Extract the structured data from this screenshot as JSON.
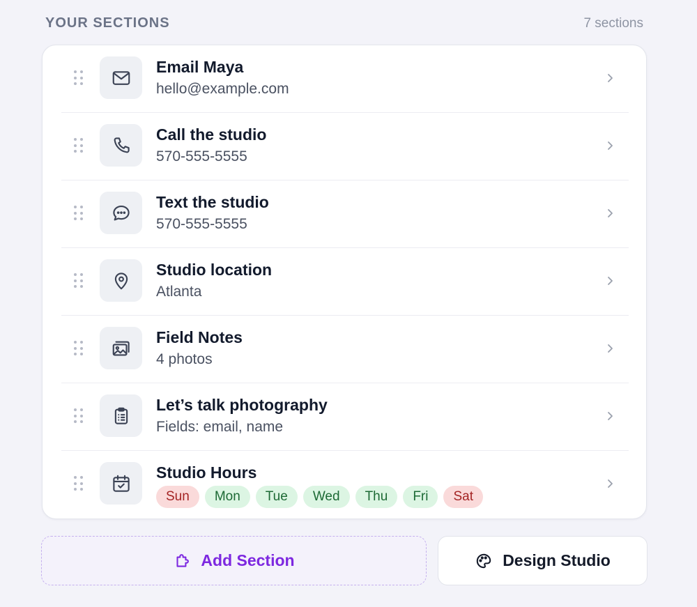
{
  "header": {
    "title": "YOUR SECTIONS",
    "count": "7 sections"
  },
  "sections": [
    {
      "icon": "mail-icon",
      "title": "Email Maya",
      "subtitle": "hello@example.com"
    },
    {
      "icon": "phone-icon",
      "title": "Call the studio",
      "subtitle": "570-555-5555"
    },
    {
      "icon": "chat-bubble-icon",
      "title": "Text the studio",
      "subtitle": "570-555-5555"
    },
    {
      "icon": "map-pin-icon",
      "title": "Studio location",
      "subtitle": "Atlanta"
    },
    {
      "icon": "photo-gallery-icon",
      "title": "Field Notes",
      "subtitle": "4 photos"
    },
    {
      "icon": "clipboard-list-icon",
      "title": "Let’s talk photography",
      "subtitle": "Fields: email, name"
    },
    {
      "icon": "calendar-check-icon",
      "title": "Studio Hours",
      "days": [
        {
          "label": "Sun",
          "status": "closed"
        },
        {
          "label": "Mon",
          "status": "open"
        },
        {
          "label": "Tue",
          "status": "open"
        },
        {
          "label": "Wed",
          "status": "open"
        },
        {
          "label": "Thu",
          "status": "open"
        },
        {
          "label": "Fri",
          "status": "open"
        },
        {
          "label": "Sat",
          "status": "closed"
        }
      ]
    }
  ],
  "actions": {
    "add_section": {
      "label": "Add Section",
      "icon": "puzzle-piece-icon"
    },
    "design_studio": {
      "label": "Design Studio",
      "icon": "palette-icon"
    }
  },
  "colors": {
    "accent": "#7d28e0",
    "open_bg": "#dcf5e3",
    "open_text": "#1d6a35",
    "closed_bg": "#fadada",
    "closed_text": "#a42424"
  }
}
